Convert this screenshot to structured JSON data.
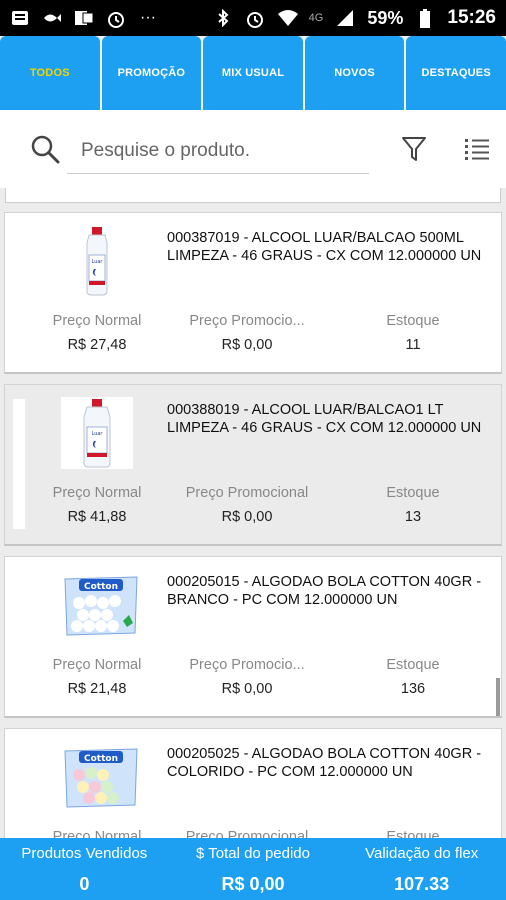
{
  "status_bar": {
    "battery": "59%",
    "time": "15:26",
    "network": "4G",
    "dots": "···"
  },
  "tabs": [
    {
      "label": "TODOS",
      "active": true
    },
    {
      "label": "PROMOÇÃO",
      "active": false
    },
    {
      "label": "MIX USUAL",
      "active": false
    },
    {
      "label": "NOVOS",
      "active": false
    },
    {
      "label": "DESTAQUES",
      "active": false
    }
  ],
  "search": {
    "placeholder": "Pesquise o produto.",
    "value": ""
  },
  "labels": {
    "normal_price": "Preço Normal",
    "promo_price_short": "Preço Promocio...",
    "promo_price": "Preço Promocional",
    "stock": "Estoque"
  },
  "products": [
    {
      "description": "000387019  - ALCOOL LUAR/BALCAO 500ML LIMPEZA - 46 GRAUS - CX COM 12.000000 UN",
      "normal_price": "R$ 27,48",
      "promo_price": "R$ 0,00",
      "stock": "11",
      "image": "alcohol-bottle-image"
    },
    {
      "description": "000388019  - ALCOOL LUAR/BALCAO1 LT LIMPEZA - 46 GRAUS - CX COM 12.000000 UN",
      "normal_price": "R$ 41,88",
      "promo_price": "R$ 0,00",
      "stock": "13",
      "image": "alcohol-bottle-image"
    },
    {
      "description": "000205015  - ALGODAO BOLA COTTON 40GR - BRANCO - PC COM 12.000000 UN",
      "normal_price": "R$ 21,48",
      "promo_price": "R$ 0,00",
      "stock": "136",
      "image": "cotton-bag-image"
    },
    {
      "description": "000205025  - ALGODAO BOLA COTTON 40GR - COLORIDO - PC COM 12.000000 UN",
      "normal_price": "",
      "promo_price": "",
      "stock": "",
      "image": "cotton-bag-colored-image"
    }
  ],
  "footer": {
    "sold_label": "Produtos Vendidos",
    "sold_value": "0",
    "total_label": "$ Total do pedido",
    "total_value": "R$ 0,00",
    "flex_label": "Validação do flex",
    "flex_value": "107.33"
  },
  "colors": {
    "primary": "#1ea0f2",
    "active_tab_text": "#f0d400",
    "selected_row": "#ebebeb"
  }
}
